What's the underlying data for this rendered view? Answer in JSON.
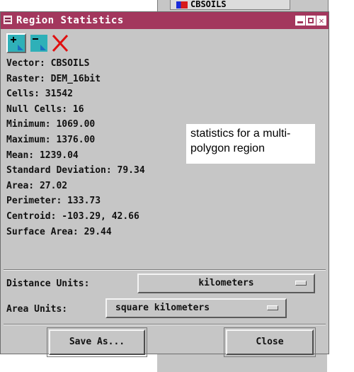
{
  "background_window": {
    "tab_label": "CBSOILS"
  },
  "window": {
    "title": "Region Statistics",
    "title_bar_color": "#a3375d"
  },
  "toolbar": {
    "tools": [
      {
        "name": "add-region",
        "icon": "plus-region-icon",
        "color": "#2fb0b8"
      },
      {
        "name": "remove-region",
        "icon": "minus-region-icon",
        "color": "#2fb0b8"
      },
      {
        "name": "clear",
        "icon": "red-x-icon",
        "color": "#e01010"
      }
    ]
  },
  "stats": {
    "vector": "Vector: CBSOILS",
    "raster": "Raster: DEM_16bit",
    "cells": "Cells: 31542",
    "null_cells": "Null Cells: 16",
    "minimum": "Minimum: 1069.00",
    "maximum": "Maximum: 1376.00",
    "mean": "Mean: 1239.04",
    "std_dev": "Standard Deviation: 79.34",
    "area": "Area: 27.02",
    "perimeter": "Perimeter: 133.73",
    "centroid": "Centroid: -103.29, 42.66",
    "surface_area": "Surface Area: 29.44"
  },
  "callout": "statistics for a multi-polygon region",
  "units": {
    "distance_label": "Distance Units:",
    "distance_value": "kilometers",
    "area_label": "Area Units:",
    "area_value": "square kilometers"
  },
  "buttons": {
    "save_as": "Save As...",
    "close": "Close"
  }
}
